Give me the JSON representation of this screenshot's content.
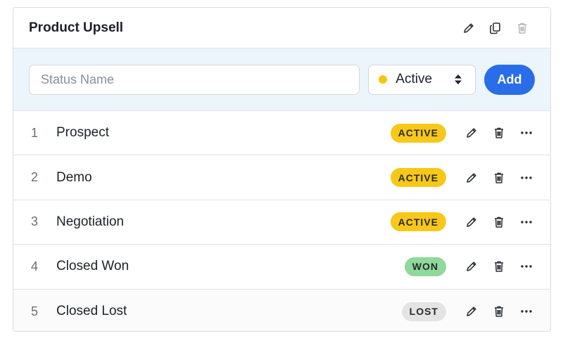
{
  "header": {
    "title": "Product Upsell"
  },
  "form": {
    "name_placeholder": "Status Name",
    "selected_status": "Active",
    "selected_status_color": "#f5c511",
    "add_label": "Add"
  },
  "colors": {
    "accent": "#2a6de8",
    "active_badge": "#f7c81a",
    "won_badge": "#8fd99a",
    "lost_badge": "#e4e4e4",
    "toolbar_bg": "#edf5fc"
  },
  "rows": [
    {
      "num": "1",
      "label": "Prospect",
      "badge": "ACTIVE",
      "badge_kind": "active"
    },
    {
      "num": "2",
      "label": "Demo",
      "badge": "ACTIVE",
      "badge_kind": "active"
    },
    {
      "num": "3",
      "label": "Negotiation",
      "badge": "ACTIVE",
      "badge_kind": "active"
    },
    {
      "num": "4",
      "label": "Closed Won",
      "badge": "WON",
      "badge_kind": "won"
    },
    {
      "num": "5",
      "label": "Closed Lost",
      "badge": "LOST",
      "badge_kind": "lost"
    }
  ]
}
